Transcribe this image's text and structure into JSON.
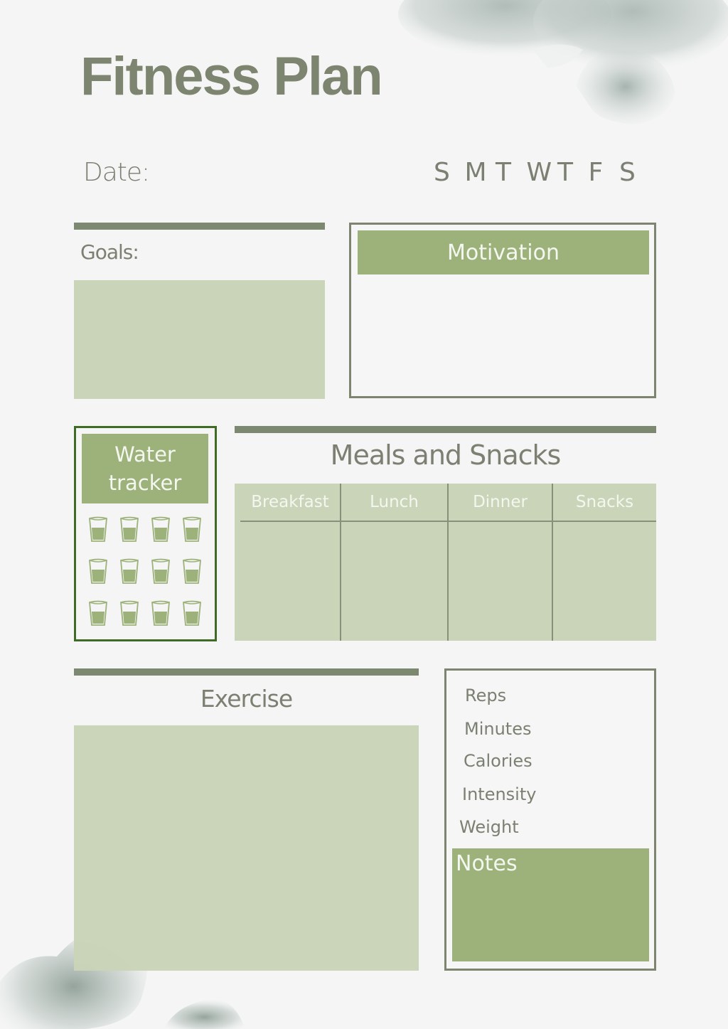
{
  "page": {
    "title": "Fitness Plan",
    "colors": {
      "background": "#f4f5f4",
      "title_text": "#7d8571",
      "body_text": "#7b8072",
      "rule_bar": "#7d8870",
      "light_fill": "#c9d4b8",
      "accent_fill": "#9db27a",
      "water_border": "#3e6b26"
    }
  },
  "date": {
    "label": "Date:",
    "days": [
      "S",
      "M",
      "T",
      "W",
      "T",
      "F",
      "S"
    ]
  },
  "goals": {
    "label": "Goals:"
  },
  "motivation": {
    "label": "Motivation"
  },
  "water_tracker": {
    "label_line1": "Water",
    "label_line2": "tracker",
    "glass_icon": "water-glass-icon",
    "glass_count": 12
  },
  "meals": {
    "title": "Meals and Snacks",
    "columns": [
      "Breakfast",
      "Lunch",
      "Dinner",
      "Snacks"
    ]
  },
  "exercise": {
    "title": "Exercise"
  },
  "stats": {
    "items": [
      "Reps",
      "Minutes",
      "Calories",
      "Intensity",
      "Weight"
    ]
  },
  "notes": {
    "label": "Notes"
  }
}
